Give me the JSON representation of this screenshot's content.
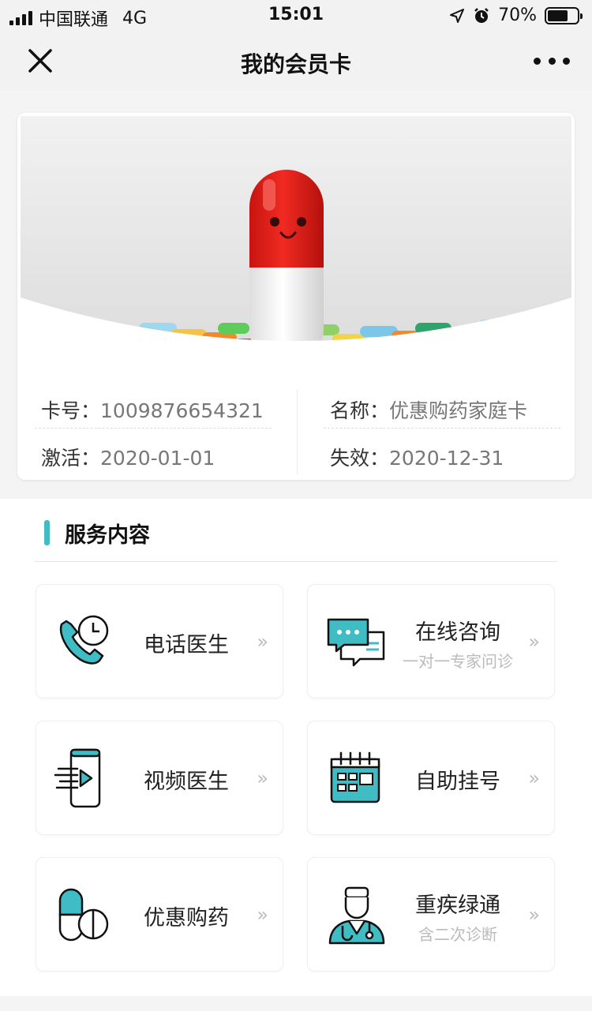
{
  "status_bar": {
    "carrier": "中国联通",
    "network": "4G",
    "time": "15:01",
    "battery": "70%",
    "battery_level": 0.7
  },
  "nav": {
    "title": "我的会员卡"
  },
  "card": {
    "number_label": "卡号：",
    "number_value": "1009876654321",
    "name_label": "名称：",
    "name_value": "优惠购药家庭卡",
    "activate_label": "激活：",
    "activate_value": "2020-01-01",
    "expire_label": "失效：",
    "expire_value": "2020-12-31"
  },
  "services": {
    "title": "服务内容",
    "items": [
      {
        "title": "电话医生",
        "subtitle": "",
        "icon": "phone-clock-icon"
      },
      {
        "title": "在线咨询",
        "subtitle": "一对一专家问诊",
        "icon": "chat-bubbles-icon"
      },
      {
        "title": "视频医生",
        "subtitle": "",
        "icon": "video-phone-icon"
      },
      {
        "title": "自助挂号",
        "subtitle": "",
        "icon": "calendar-icon"
      },
      {
        "title": "优惠购药",
        "subtitle": "",
        "icon": "pill-capsule-icon"
      },
      {
        "title": "重疾绿通",
        "subtitle": "含二次诊断",
        "icon": "doctor-icon"
      }
    ],
    "chevron": "»"
  },
  "colors": {
    "accent": "#3fbcc4",
    "capsule_red": "#e8211b"
  }
}
